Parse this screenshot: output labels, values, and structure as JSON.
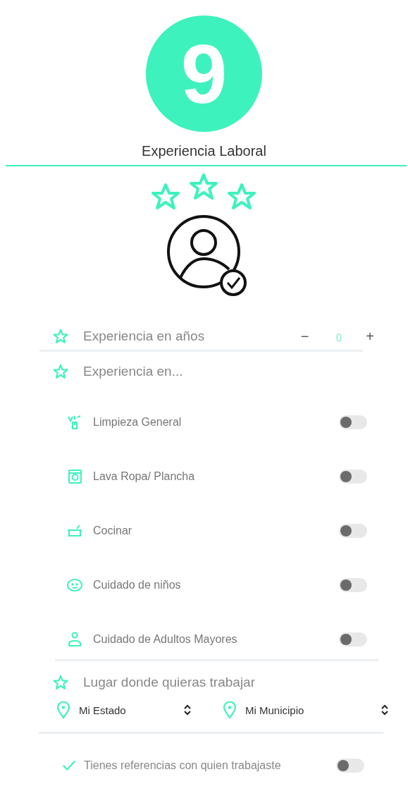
{
  "step_badge": {
    "number": "9"
  },
  "title": "Experiencia Laboral",
  "years": {
    "label": "Experiencia en años",
    "minus": "−",
    "value": "0",
    "plus": "+"
  },
  "experience": {
    "label": "Experiencia en...",
    "items": [
      {
        "kind": "cleaning",
        "label": "Limpieza General",
        "on": false
      },
      {
        "kind": "laundry",
        "label": "Lava Ropa/ Plancha",
        "on": false
      },
      {
        "kind": "cooking",
        "label": "Cocinar",
        "on": false
      },
      {
        "kind": "child",
        "label": "Cuidado de niños",
        "on": false
      },
      {
        "kind": "elder",
        "label": "Cuidado de Adultos Mayores",
        "on": false
      }
    ]
  },
  "location": {
    "label": "Lugar donde quieras trabajar",
    "selects": [
      "Mi Estado",
      "Mi Municipio"
    ]
  },
  "references": {
    "label": "Tienes referencias con quien trabajaste",
    "on": false
  }
}
